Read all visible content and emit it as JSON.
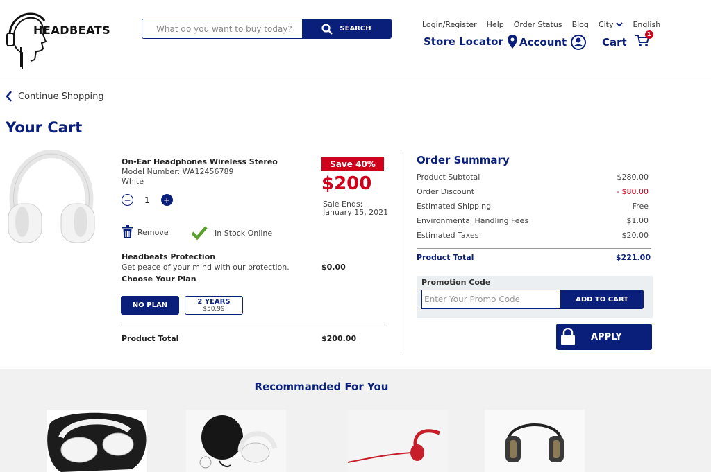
{
  "header": {
    "logo_text": "HEADBEATS",
    "search_placeholder": "What do you want to buy today?",
    "search_button": "SEARCH",
    "top_links": [
      "Login/Register",
      "Help",
      "Order Status",
      "Blog",
      "City",
      "English"
    ],
    "store_locator": "Store Locator",
    "account": "Account",
    "cart": "Cart",
    "cart_count": "1"
  },
  "nav": {
    "continue_shopping": "Continue Shopping"
  },
  "page_title": "Your Cart",
  "product": {
    "name": "On-Ear Headphones Wireless Stereo",
    "model": "Model Number: WA12456789",
    "color": "White",
    "quantity": "1",
    "save_badge": "Save 40%",
    "price": "$200",
    "sale_ends_label": "Sale Ends:",
    "sale_ends_date": "January 15, 2021",
    "remove": "Remove",
    "stock": "In Stock Online",
    "protection_title": "Headbeats Protection",
    "protection_desc": "Get peace of your mind with our protection.",
    "protection_price": "$0.00",
    "choose_plan": "Choose Your Plan",
    "plan_no": "NO PLAN",
    "plan_2y": "2 YEARS",
    "plan_2y_price": "$50.99",
    "total_label": "Product Total",
    "total_value": "$200.00"
  },
  "summary": {
    "title": "Order Summary",
    "rows": [
      {
        "label": "Product Subtotal",
        "value": "$280.00"
      },
      {
        "label": "Order Discount",
        "value": "- $80.00"
      },
      {
        "label": "Estimated Shipping",
        "value": "Free"
      },
      {
        "label": "Environmental Handling Fees",
        "value": "$1.00"
      },
      {
        "label": "Estimated Taxes",
        "value": "$20.00"
      }
    ],
    "total_label": "Product Total",
    "total_value": "$221.00",
    "promo_label": "Promotion Code",
    "promo_placeholder": "Enter Your Promo Code",
    "promo_button": "ADD TO CART",
    "apply_button": "APPLY"
  },
  "recommended": {
    "title": "Recommanded For You"
  },
  "colors": {
    "accent": "#0a1f7a",
    "sale": "#d0021b",
    "stock_check": "#5aa02c"
  }
}
